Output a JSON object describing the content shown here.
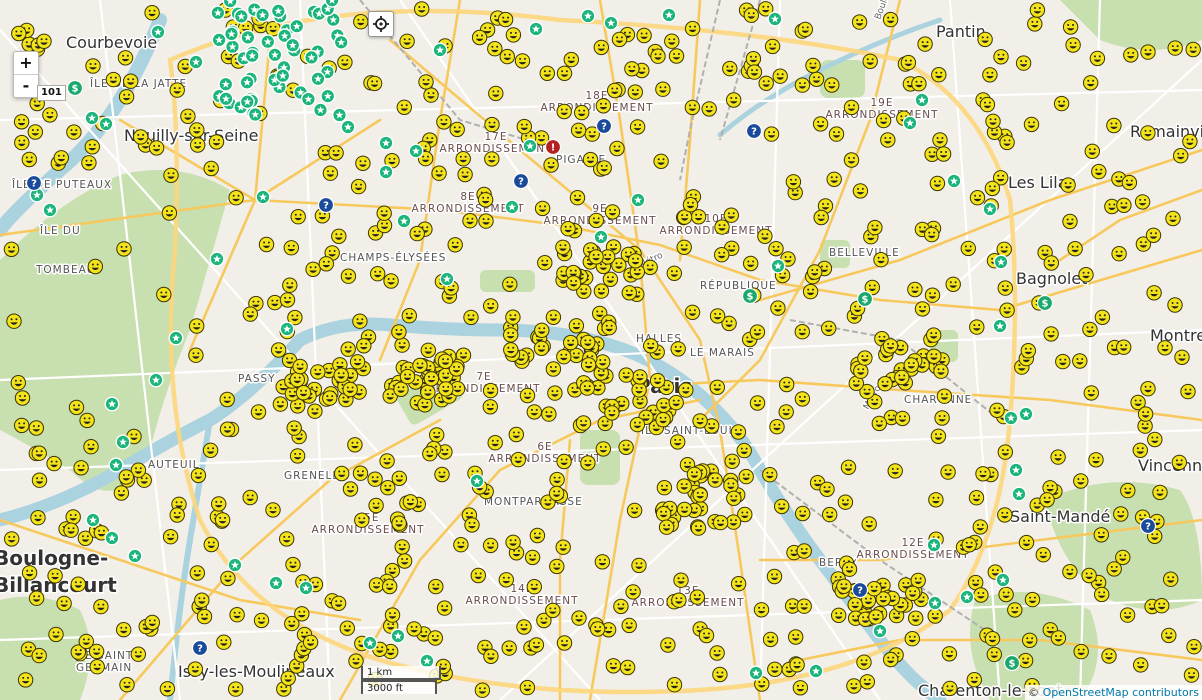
{
  "map": {
    "place_labels": [
      {
        "text": "Courbevoie",
        "cls": "lbl-town"
      },
      {
        "text": "ÎLE DE LA JATTE",
        "cls": "lbl-quarter"
      },
      {
        "text": "Neuilly-sur-Seine",
        "cls": "lbl-town"
      },
      {
        "text": "ÎLE DE PUTEAUX",
        "cls": "lbl-quarter"
      },
      {
        "text": "ÎLE DU",
        "cls": "lbl-quarter"
      },
      {
        "text": "TOMBEAU",
        "cls": "lbl-quarter"
      },
      {
        "text": "CHAMPS-ÉLYSÉES",
        "cls": "lbl-quarter"
      },
      {
        "text": "PASSY",
        "cls": "lbl-quarter"
      },
      {
        "text": "AUTEUIL",
        "cls": "lbl-quarter"
      },
      {
        "text": "GRENELLE",
        "cls": "lbl-quarter"
      },
      {
        "text": "Boulogne-",
        "cls": "lbl-big"
      },
      {
        "text": "Billancourt",
        "cls": "lbl-big"
      },
      {
        "text": "ÎLE SAINT-",
        "cls": "lbl-quarter"
      },
      {
        "text": "GERMAIN",
        "cls": "lbl-quarter"
      },
      {
        "text": "Issy-les-Moulineaux",
        "cls": "lbl-town"
      },
      {
        "text": "Pantin",
        "cls": "lbl-town"
      },
      {
        "text": "Les Lilas",
        "cls": "lbl-town"
      },
      {
        "text": "Bagnolet",
        "cls": "lbl-town"
      },
      {
        "text": "Romainville",
        "cls": "lbl-town"
      },
      {
        "text": "Montreuil",
        "cls": "lbl-town"
      },
      {
        "text": "Vincennes",
        "cls": "lbl-town"
      },
      {
        "text": "Saint-Mandé",
        "cls": "lbl-town"
      },
      {
        "text": "Charenton-le-Pont",
        "cls": "lbl-town"
      },
      {
        "text": "Paris",
        "cls": "lbl-big"
      },
      {
        "text": "PIGALLE",
        "cls": "lbl-quarter"
      },
      {
        "text": "BELLEVILLE",
        "cls": "lbl-quarter"
      },
      {
        "text": "RÉPUBLIQUE",
        "cls": "lbl-quarter"
      },
      {
        "text": "LE MARAIS",
        "cls": "lbl-quarter"
      },
      {
        "text": "MONTPARNASSE",
        "cls": "lbl-quarter"
      },
      {
        "text": "BERCY",
        "cls": "lbl-quarter"
      },
      {
        "text": "HALLES",
        "cls": "lbl-quarter"
      },
      {
        "text": "ÎLE SAINT-LOUIS",
        "cls": "lbl-quarter"
      },
      {
        "text": "CHARONNE",
        "cls": "lbl-quarter"
      }
    ],
    "district_labels": [
      {
        "line1": "17E",
        "line2": "ARRONDISSEMENT"
      },
      {
        "line1": "18E",
        "line2": "ARRONDISSEMENT"
      },
      {
        "line1": "19E",
        "line2": "ARRONDISSEMENT"
      },
      {
        "line1": "8E",
        "line2": "ARRONDISSEMENT"
      },
      {
        "line1": "9E",
        "line2": "ARRONDISSEMENT"
      },
      {
        "line1": "10E",
        "line2": "ARRONDISSEMENT"
      },
      {
        "line1": "7E",
        "line2": "ARRONDISSEMENT"
      },
      {
        "line1": "6E",
        "line2": "ARRONDISSEMENT"
      },
      {
        "line1": "15E",
        "line2": "ARRONDISSEMENT"
      },
      {
        "line1": "14E",
        "line2": "ARRONDISSEMENT"
      },
      {
        "line1": "13E",
        "line2": "ARRONDISSEMENT"
      },
      {
        "line1": "12E",
        "line2": "ARRONDISSEMENT"
      }
    ],
    "street_labels": [
      "Métro",
      "Métro 9",
      "Boulevard Périphérique"
    ],
    "colors": {
      "land": "#f2efe9",
      "park": "#c8dfb0",
      "water": "#aad3df",
      "road_primary": "#fcd67c",
      "road_secondary": "#ffffff",
      "smiley": "#f3e31b",
      "star_marker": "#1bb57c",
      "info_marker": "#1a4a9a",
      "atm_marker": "#1aa86d",
      "toilet_marker": "#b22222"
    }
  },
  "controls": {
    "zoom_in_label": "+",
    "zoom_out_label": "-",
    "zoom_level": "101",
    "locate_icon": "crosshair-icon"
  },
  "scale": {
    "metric": "1 km",
    "imperial": "3000 ft"
  },
  "attribution": {
    "prefix": "© ",
    "text": "OpenStreetMap contributors"
  }
}
